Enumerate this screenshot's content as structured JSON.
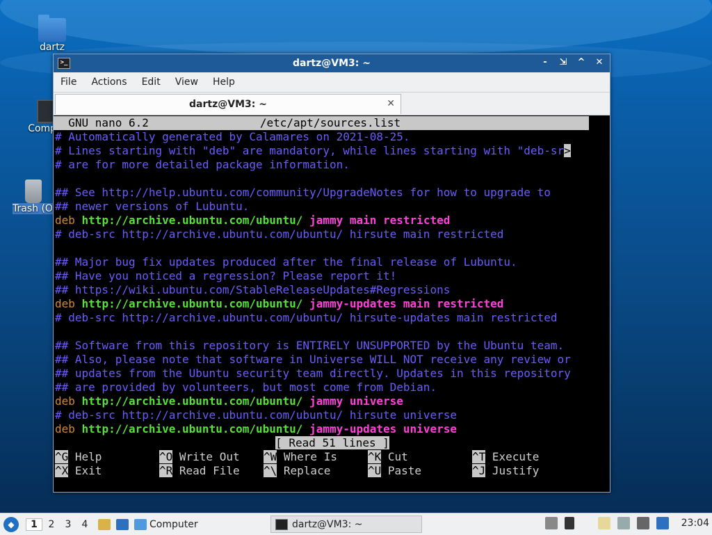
{
  "desktop": {
    "icons": [
      {
        "label": "dartz"
      },
      {
        "label": "Computer"
      },
      {
        "label": "Trash (Oth"
      }
    ]
  },
  "window": {
    "title": "dartz@VM3: ~",
    "buttons": [
      "-",
      "⇲",
      "^",
      "✕"
    ],
    "menu": [
      "File",
      "Actions",
      "Edit",
      "View",
      "Help"
    ],
    "tab": {
      "label": "dartz@VM3: ~",
      "close": "✕"
    }
  },
  "nano": {
    "header_left": "  GNU nano 6.2",
    "header_file": "/etc/apt/sources.list",
    "lines": [
      {
        "t": "comment",
        "text": "# Automatically generated by Calamares on 2021-08-25."
      },
      {
        "t": "comment-trunc",
        "text": "# Lines starting with \"deb\" are mandatory, while lines starting with \"deb-sr",
        "more": ">"
      },
      {
        "t": "comment",
        "text": "# are for more detailed package information."
      },
      {
        "t": "blank",
        "text": ""
      },
      {
        "t": "comment",
        "text": "## See http://help.ubuntu.com/community/UpgradeNotes for how to upgrade to"
      },
      {
        "t": "comment",
        "text": "## newer versions of Lubuntu."
      },
      {
        "t": "deb",
        "deb": "deb",
        "url": " http://archive.ubuntu.com/ubuntu/",
        "kw": " jammy main restricted"
      },
      {
        "t": "comment",
        "text": "# deb-src http://archive.ubuntu.com/ubuntu/ hirsute main restricted"
      },
      {
        "t": "blank",
        "text": ""
      },
      {
        "t": "comment",
        "text": "## Major bug fix updates produced after the final release of Lubuntu."
      },
      {
        "t": "comment",
        "text": "## Have you noticed a regression? Please report it!"
      },
      {
        "t": "comment",
        "text": "## https://wiki.ubuntu.com/StableReleaseUpdates#Regressions"
      },
      {
        "t": "deb",
        "deb": "deb",
        "url": " http://archive.ubuntu.com/ubuntu/",
        "kw": " jammy-updates main restricted"
      },
      {
        "t": "comment",
        "text": "# deb-src http://archive.ubuntu.com/ubuntu/ hirsute-updates main restricted"
      },
      {
        "t": "blank",
        "text": ""
      },
      {
        "t": "comment",
        "text": "## Software from this repository is ENTIRELY UNSUPPORTED by the Ubuntu team."
      },
      {
        "t": "comment",
        "text": "## Also, please note that software in Universe WILL NOT receive any review or"
      },
      {
        "t": "comment",
        "text": "## updates from the Ubuntu security team directly. Updates in this repository"
      },
      {
        "t": "comment",
        "text": "## are provided by volunteers, but most come from Debian."
      },
      {
        "t": "deb",
        "deb": "deb",
        "url": " http://archive.ubuntu.com/ubuntu/",
        "kw": " jammy universe"
      },
      {
        "t": "comment",
        "text": "# deb-src http://archive.ubuntu.com/ubuntu/ hirsute universe"
      },
      {
        "t": "deb",
        "deb": "deb",
        "url": " http://archive.ubuntu.com/ubuntu/",
        "kw": " jammy-updates universe"
      }
    ],
    "status": "[ Read 51 lines ]",
    "shortcuts": [
      [
        {
          "k": "^G",
          "l": " Help"
        },
        {
          "k": "^O",
          "l": " Write Out"
        },
        {
          "k": "^W",
          "l": " Where Is"
        },
        {
          "k": "^K",
          "l": " Cut"
        },
        {
          "k": "^T",
          "l": " Execute"
        }
      ],
      [
        {
          "k": "^X",
          "l": " Exit"
        },
        {
          "k": "^R",
          "l": " Read File"
        },
        {
          "k": "^\\",
          "l": " Replace"
        },
        {
          "k": "^U",
          "l": " Paste"
        },
        {
          "k": "^J",
          "l": " Justify"
        }
      ]
    ]
  },
  "taskbar": {
    "workspaces": [
      "1",
      "2",
      "3",
      "4"
    ],
    "computer_label": "Computer",
    "task_label": "dartz@VM3: ~",
    "clock": "23:04"
  },
  "colors": {
    "comment": "#6a5cff",
    "deb": "#d08a3b",
    "url": "#58e03a",
    "keyword": "#ff40d9",
    "titlebar": "#1f5a98"
  }
}
